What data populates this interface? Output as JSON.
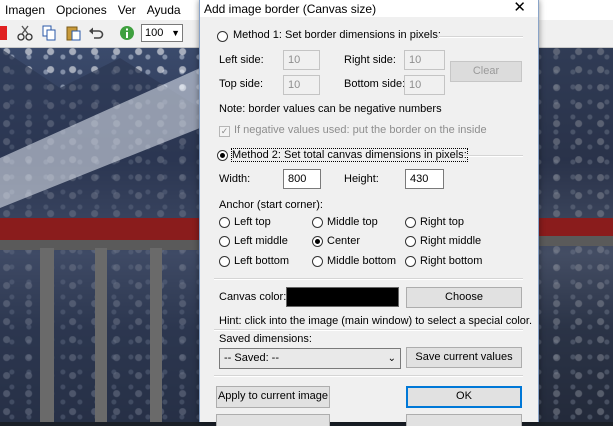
{
  "app": {
    "menu": [
      "Imagen",
      "Opciones",
      "Ver",
      "Ayuda"
    ],
    "zoom_value": "100",
    "toolbar_icons": [
      "close-red-icon",
      "cut-icon",
      "copy-icon",
      "paste-icon",
      "undo-icon",
      "info-icon"
    ]
  },
  "dialog": {
    "title": "Add image border (Canvas size)",
    "method1": {
      "label": "Method 1: Set border dimensions in pixels:",
      "left_label": "Left side:",
      "left_value": "10",
      "right_label": "Right side:",
      "right_value": "10",
      "top_label": "Top side:",
      "top_value": "10",
      "bottom_label": "Bottom side:",
      "bottom_value": "10",
      "clear_label": "Clear",
      "note": "Note: border values can be negative  numbers",
      "negative_inside_label": "If negative values used: put the border on the inside",
      "negative_inside_checked": true
    },
    "method2": {
      "label": "Method 2: Set total canvas dimensions in pixels:",
      "width_label": "Width:",
      "width_value": "800",
      "height_label": "Height:",
      "height_value": "430"
    },
    "anchor": {
      "label": "Anchor (start corner):",
      "options": [
        "Left top",
        "Middle top",
        "Right top",
        "Left middle",
        "Center",
        "Right middle",
        "Left bottom",
        "Middle bottom",
        "Right bottom"
      ],
      "selected": "Center"
    },
    "canvas_color": {
      "label": "Canvas color:",
      "value": "#000000",
      "choose_label": "Choose",
      "hint": "Hint: click into the image (main window) to select a special color."
    },
    "saved": {
      "label": "Saved dimensions:",
      "selected_value": "-- Saved: --",
      "save_label": "Save current values"
    },
    "apply_label": "Apply to current image",
    "ok_label": "OK"
  }
}
